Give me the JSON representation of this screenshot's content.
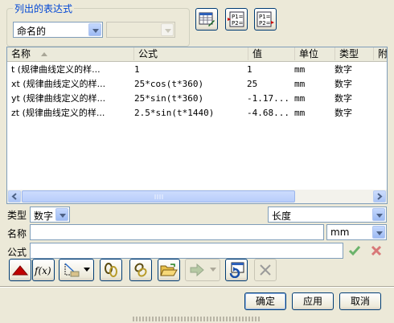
{
  "listing": {
    "group_title": "列出的表达式",
    "filter_combo": "命名的",
    "secondary_combo": ""
  },
  "table": {
    "columns": [
      "名称",
      "公式",
      "值",
      "单位",
      "类型",
      "附"
    ],
    "rows": [
      {
        "name": "t  (规律曲线定义的样...",
        "formula": "1",
        "value": "1",
        "unit": "mm",
        "type": "数字"
      },
      {
        "name": "xt  (规律曲线定义的样...",
        "formula": "25*cos(t*360)",
        "value": "25",
        "unit": "mm",
        "type": "数字"
      },
      {
        "name": "yt  (规律曲线定义的样...",
        "formula": "25*sin(t*360)",
        "value": "-1.17...",
        "unit": "mm",
        "type": "数字"
      },
      {
        "name": "zt  (规律曲线定义的样...",
        "formula": "2.5*sin(t*1440)",
        "value": "-4.68...",
        "unit": "mm",
        "type": "数字"
      }
    ]
  },
  "editor": {
    "type_label": "类型",
    "type_value": "数字",
    "dimension_value": "长度",
    "name_label": "名称",
    "name_value": "",
    "unit_value": "mm",
    "formula_label": "公式",
    "formula_value": ""
  },
  "buttons": {
    "ok": "确定",
    "apply": "应用",
    "cancel": "取消"
  },
  "colors": {
    "accent": "#0046d5",
    "selection": "#316ac5"
  }
}
